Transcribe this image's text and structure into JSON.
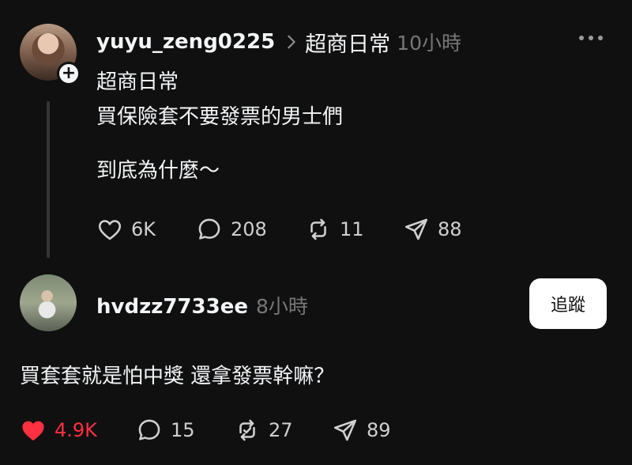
{
  "post": {
    "username": "yuyu_zeng0225",
    "topic": "超商日常",
    "time": "10小時",
    "lines": [
      "超商日常",
      "買保險套不要發票的男士們",
      "到底為什麼～"
    ],
    "likes": "6K",
    "replies": "208",
    "reposts": "11",
    "shares": "88"
  },
  "reply": {
    "username": "hvdzz7733ee",
    "time": "8小時",
    "follow_label": "追蹤",
    "text": "買套套就是怕中獎 還拿發票幹嘛？",
    "likes": "4.9K",
    "replies": "15",
    "reposts": "27",
    "shares": "89"
  },
  "colors": {
    "background": "#101010",
    "text": "#f3f5f7",
    "muted": "#777777",
    "liked": "#ff3040"
  }
}
